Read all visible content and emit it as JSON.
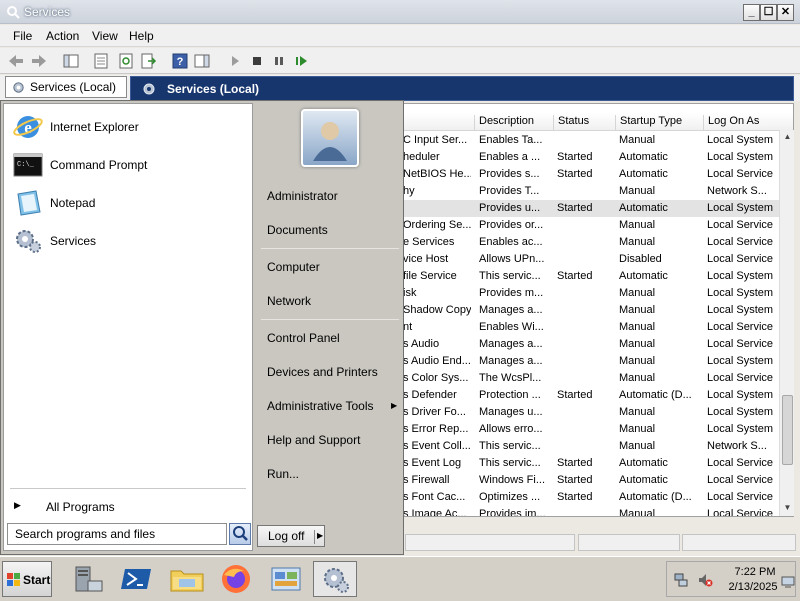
{
  "window": {
    "title": "Services",
    "buttons": {
      "minimize": "_",
      "maximize": "☐",
      "close": "✕"
    }
  },
  "menu": [
    "File",
    "Action",
    "View",
    "Help"
  ],
  "scope_tab": "Services (Local)",
  "header_title": "Services (Local)",
  "columns": [
    "Description",
    "Status",
    "Startup Type",
    "Log On As"
  ],
  "rows": [
    {
      "name": "C Input Ser...",
      "description": "Enables Ta...",
      "status": "",
      "startup": "Manual",
      "logon": "Local System"
    },
    {
      "name": "heduler",
      "description": "Enables a ...",
      "status": "Started",
      "startup": "Automatic",
      "logon": "Local System"
    },
    {
      "name": "NetBIOS He...",
      "description": "Provides s...",
      "status": "Started",
      "startup": "Automatic",
      "logon": "Local Service"
    },
    {
      "name": "hy",
      "description": "Provides T...",
      "status": "",
      "startup": "Manual",
      "logon": "Network S..."
    },
    {
      "name": "",
      "description": "Provides u...",
      "status": "Started",
      "startup": "Automatic",
      "logon": "Local System"
    },
    {
      "name": "Ordering Se...",
      "description": "Provides or...",
      "status": "",
      "startup": "Manual",
      "logon": "Local Service"
    },
    {
      "name": "e Services",
      "description": "Enables ac...",
      "status": "",
      "startup": "Manual",
      "logon": "Local Service"
    },
    {
      "name": "vice Host",
      "description": "Allows UPn...",
      "status": "",
      "startup": "Disabled",
      "logon": "Local Service"
    },
    {
      "name": "file Service",
      "description": "This servic...",
      "status": "Started",
      "startup": "Automatic",
      "logon": "Local System"
    },
    {
      "name": "isk",
      "description": "Provides m...",
      "status": "",
      "startup": "Manual",
      "logon": "Local System"
    },
    {
      "name": "Shadow Copy",
      "description": "Manages a...",
      "status": "",
      "startup": "Manual",
      "logon": "Local System"
    },
    {
      "name": "nt",
      "description": "Enables Wi...",
      "status": "",
      "startup": "Manual",
      "logon": "Local Service"
    },
    {
      "name": "s Audio",
      "description": "Manages a...",
      "status": "",
      "startup": "Manual",
      "logon": "Local Service"
    },
    {
      "name": "s Audio End...",
      "description": "Manages a...",
      "status": "",
      "startup": "Manual",
      "logon": "Local System"
    },
    {
      "name": "s Color Sys...",
      "description": "The WcsPl...",
      "status": "",
      "startup": "Manual",
      "logon": "Local Service"
    },
    {
      "name": "s Defender",
      "description": "Protection ...",
      "status": "Started",
      "startup": "Automatic (D...",
      "logon": "Local System"
    },
    {
      "name": "s Driver Fo...",
      "description": "Manages u...",
      "status": "",
      "startup": "Manual",
      "logon": "Local System"
    },
    {
      "name": "s Error Rep...",
      "description": "Allows erro...",
      "status": "",
      "startup": "Manual",
      "logon": "Local System"
    },
    {
      "name": "s Event Coll...",
      "description": "This servic...",
      "status": "",
      "startup": "Manual",
      "logon": "Network S..."
    },
    {
      "name": "s Event Log",
      "description": "This servic...",
      "status": "Started",
      "startup": "Automatic",
      "logon": "Local Service"
    },
    {
      "name": "s Firewall",
      "description": "Windows Fi...",
      "status": "Started",
      "startup": "Automatic",
      "logon": "Local Service"
    },
    {
      "name": "s Font Cac...",
      "description": "Optimizes ...",
      "status": "Started",
      "startup": "Automatic (D...",
      "logon": "Local Service"
    },
    {
      "name": "s Image Ac...",
      "description": "Provides im...",
      "status": "",
      "startup": "Manual",
      "logon": "Local Service"
    }
  ],
  "selected_row": 4,
  "start_menu": {
    "pinned": [
      {
        "label": "Internet Explorer",
        "icon": "internet-explorer-icon"
      },
      {
        "label": "Command Prompt",
        "icon": "command-prompt-icon"
      },
      {
        "label": "Notepad",
        "icon": "notepad-icon"
      },
      {
        "label": "Services",
        "icon": "services-icon"
      }
    ],
    "all_programs": "All Programs",
    "search_placeholder": "Search programs and files",
    "right_links": [
      {
        "label": "Administrator"
      },
      {
        "label": "Documents"
      },
      {
        "label": "Computer"
      },
      {
        "label": "Network"
      },
      {
        "label": "Control Panel"
      },
      {
        "label": "Devices and Printers"
      },
      {
        "label": "Administrative Tools",
        "submenu": true
      },
      {
        "label": "Help and Support"
      },
      {
        "label": "Run..."
      }
    ],
    "log_off": "Log off"
  },
  "taskbar": {
    "start_label": "Start",
    "apps": [
      "server-manager-icon",
      "powershell-icon",
      "file-explorer-icon",
      "firefox-icon",
      "control-panel-icon",
      "services-icon"
    ],
    "active_app": 5,
    "clock_time": "7:22 PM",
    "clock_date": "2/13/2025"
  },
  "colors": {
    "header_bar": "#17366e",
    "start_menu_left": "#ffffff",
    "start_menu_right": "#c9c7c0"
  }
}
